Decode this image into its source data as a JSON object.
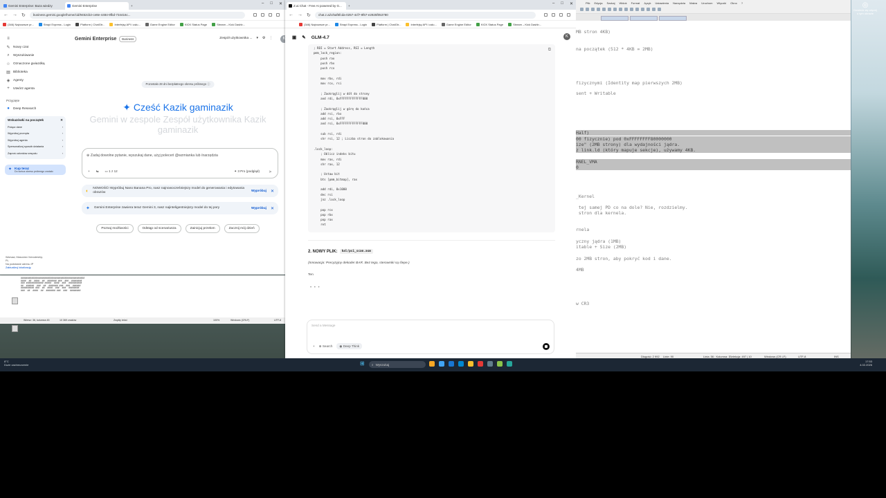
{
  "gemini_browser": {
    "tabs": [
      {
        "label": "Gemini Enterprise: Baza wiedzy"
      },
      {
        "label": "Gemini Enterprise"
      }
    ],
    "url": "business.gemini.google/home/cid/9452cb2-ce8e-4484-9fbd-734416c...",
    "bookmarks": [
      "(346) Najnowsze pr...",
      "Strapi Express - Login",
      "Platform | ChatGtr...",
      "Interfejsy API i usłu...",
      "Game Engine Editor",
      "KICK Status Page",
      "Stream – Kick Dashb..."
    ],
    "sidebar": {
      "items": [
        "Nowy czat",
        "Wyszukiwanie",
        "Oznaczone gwiazdką",
        "Biblioteka",
        "Agenty",
        "Utwórz agenta"
      ],
      "section_label": "Przypięte",
      "pinned": [
        "Deep Research"
      ],
      "tips_title": "Wskazówki na początek",
      "tips": [
        "Połącz dane",
        "Wypróbuj prompta",
        "Wypróbuj agenta",
        "Spersonalizuj sposób działania",
        "Zaproś członków zespołu"
      ],
      "buy_title": "Kup teraz",
      "buy_sub": "Do końca okresu próbnego zostało",
      "location": [
        "Warsaw, Masovian Voivodeship,",
        "PL",
        "Na podstawie adresu IP"
      ],
      "location_link": "Zaktualizuj lokalizację"
    },
    "main": {
      "brand": "Gemini Enterprise",
      "badge": "Business",
      "team": "Zespół użytkownika ...",
      "avatar": "K",
      "trial": "Pozostało 28 dni bezpłatnego okresu próbnego ⓘ",
      "greeting": "✦ Cześć Kazik gaminazik",
      "subtitle": "Gemini w zespole Zespół użytkownika Kazik gaminazik",
      "chat_placeholder": "Zadaj dowolne pytanie, wyszukaj dane, użyj poleceń @wzmianka lub /narzędzia",
      "tools": [
        "+",
        "⇆",
        "1 z 12"
      ],
      "model": "✦ 3 Pro (podgląd)",
      "notices": [
        {
          "text": "NOWOŚĆ! Wypróbuj Nano Banana Pro, nasz najnowocześniejszy model do generowania i edytowania obrazów",
          "action": "Wypróbuj"
        },
        {
          "text": "Gemini Enterprise zawiera teraz Gemini 3, nasz najinteligentniejszy model do tej pory",
          "action": "Wypróbuj"
        }
      ],
      "chips": [
        "Poznaj możliwości",
        "Odstąp od scenariusza",
        "Zainicjuj przełom",
        "Zacznij mój dzień"
      ]
    }
  },
  "glm_browser": {
    "tab": "Z.ai Chat - Free AI powered by G...",
    "url": "chat.z.ai/c/5af5fcda-0257-4cf7-9f67-e2925f053780",
    "bookmarks": [
      "(346) Najnowsze pr...",
      "Strapi Express - Login",
      "Platform | ChatGtr...",
      "Interfejsy API i usłu...",
      "Game Engine Editor",
      "KICK Status Page",
      "Stream – Kick Dashb..."
    ],
    "model": "GLM-4.7",
    "avatar": "K",
    "code": "; RDI = Start Address, RSI = Length\npmm_lock_region:\n    push rax\n    push rbx\n    push rcx\n\n    mov rbx, rdi\n    mov rcx, rsi\n\n    ; Zaokrąglij w dół do strony\n    and rdi, 0xFFFFFFFFFFFFF000\n\n    ; Zaokrąglij w górę do końca\n    add rsi, rbx\n    add rsi, 0xFFF\n    and rsi, 0xFFFFFFFFFFFFF000\n\n    sub rsi, rdi\n    shr rsi, 12 ; Liczba stron do zablokowania\n\n.lock_loop:\n    ; Oblicz indeks bitu\n    mov rax, rdi\n    shr rax, 12\n\n    ; Ustaw bit\n    bts [pmm_bitmap], rax\n\n    add rdi, 0x1000\n    dec rsi\n    jnz .lock_loop\n\n    pop rcx\n    pop rbx\n    pop rax\n    ret",
    "section_num": "2. NOWY PLIK:",
    "section_file": "hal/pci_scan.asm",
    "section_note": "(Innowacja: Precyzyjny dekoder BAR. Bez tego, sterowniki są ślepe.)",
    "partial": "Ten",
    "input_placeholder": "Send a Message",
    "search_label": "Search",
    "deep_label": "Deep Think"
  },
  "notepad": {
    "menu": [
      "Plik",
      "Edycja",
      "Szukaj",
      "Widok",
      "Format",
      "Język",
      "Ustawienia",
      "Narzędzia",
      "Makra",
      "Uruchom",
      "Wtyczki",
      "Okno",
      "?"
    ],
    "lines": [
      {
        "text": "MB stron 4KB)",
        "sel": false
      },
      {
        "text": "na początek (512 * 4KB = 2MB)",
        "sel": false
      },
      {
        "text": "fizycznymi (Identity map pierwszych 2MB)",
        "sel": false
      },
      {
        "text": "sent + Writable",
        "sel": false
      },
      {
        "text": "Half)",
        "sel": true
      },
      {
        "text": "00 fizycznie) pod 0xFFFFFFFF80000000",
        "sel": true
      },
      {
        "text": "ize\" (2MB strony) dla wydajności jądra.",
        "sel": true
      },
      {
        "text": "z link.ld (który mapuje sekcje), używamy 4KB.",
        "sel": true
      },
      {
        "text": "RNEL_VMA",
        "sel": true
      },
      {
        "text": "0",
        "sel": true
      },
      {
        "text": "_Kernel",
        "sel": false
      },
      {
        "text": " tej samej PD co na dole? Nie, rozdzielmy.",
        "sel": false
      },
      {
        "text": " stron dla kernela.",
        "sel": false
      },
      {
        "text": "rnela",
        "sel": false
      },
      {
        "text": "yczny jądra (1MB)",
        "sel": false
      },
      {
        "text": "itable + Size (2MB)",
        "sel": false
      },
      {
        "text": "zo 2MB stron, aby pokryć kod i dane.",
        "sel": false
      },
      {
        "text": "4MB",
        "sel": false
      },
      {
        "text": "w CR3",
        "sel": false
      }
    ],
    "status": [
      "Długość: 2 992",
      "Linie: 90",
      "Linia: 56 : Kolumna: 1",
      "Selekcja: 497 | 10",
      "Windows (CR LF)",
      "UTF-8",
      "INS"
    ]
  },
  "background": {
    "status": [
      "Wiersz: 36, kolumna 45",
      "10 369 znaków",
      "Zwykły tekst",
      "100%",
      "Windows (CRLF)",
      "UTF-8"
    ]
  },
  "taskbar": {
    "weather_temp": "8°C",
    "weather_desc": "Duże zachmurzenie",
    "search": "Wyszukaj",
    "time": "17:53",
    "date": "4.02.2026",
    "shortcut": "Dowiedz się więcej o tym obrazie"
  }
}
